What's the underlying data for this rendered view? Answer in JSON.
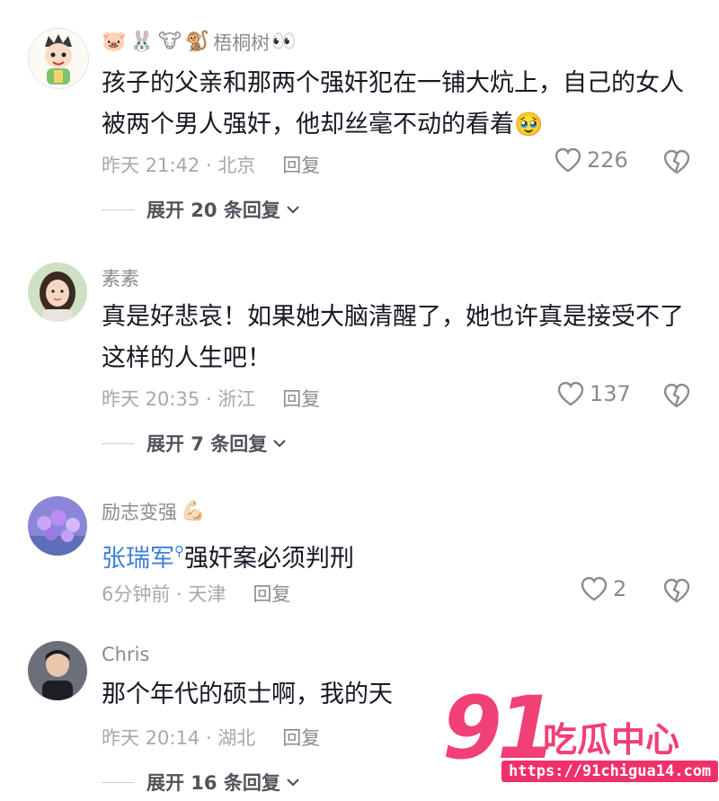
{
  "comments": [
    {
      "username_emojis": [
        "🐷",
        "🐰",
        "🐮",
        "🐒"
      ],
      "username": "梧桐树",
      "username_suffix": "👀",
      "text": "孩子的父亲和那两个强奸犯在一铺大炕上，自己的女人被两个男人强奸，他却丝毫不动的看着",
      "text_emoji": "🥹",
      "time_location": "昨天 21:42 · 北京",
      "reply_label": "回复",
      "likes": "226",
      "expand_label": "展开 20 条回复"
    },
    {
      "username": "素素",
      "text": "真是好悲哀！如果她大脑清醒了，她也许真是接受不了这样的人生吧！",
      "time_location": "昨天 20:35 · 浙江",
      "reply_label": "回复",
      "likes": "137",
      "expand_label": "展开 7 条回复"
    },
    {
      "username": "励志变强",
      "username_suffix": "💪🏻",
      "mention": "张瑞军",
      "text": "强奸案必须判刑",
      "time_location": "6分钟前 · 天津",
      "reply_label": "回复",
      "likes": "2"
    },
    {
      "username": "Chris",
      "text": "那个年代的硕士啊，我的天",
      "time_location": "昨天 20:14 · 湖北",
      "reply_label": "回复",
      "expand_label": "展开 16 条回复"
    }
  ],
  "icons": {
    "like": "heart-outline-icon",
    "dislike": "broken-heart-icon",
    "expand": "chevron-down-icon",
    "mention_search": "search-icon"
  },
  "colors": {
    "text": "#161823",
    "muted": "#8a8b91",
    "mention": "#3d7fd6",
    "watermark": "#f0306a"
  },
  "watermark": {
    "number": "91",
    "brand": "吃瓜中心",
    "url": "https://91chigua14.com"
  }
}
